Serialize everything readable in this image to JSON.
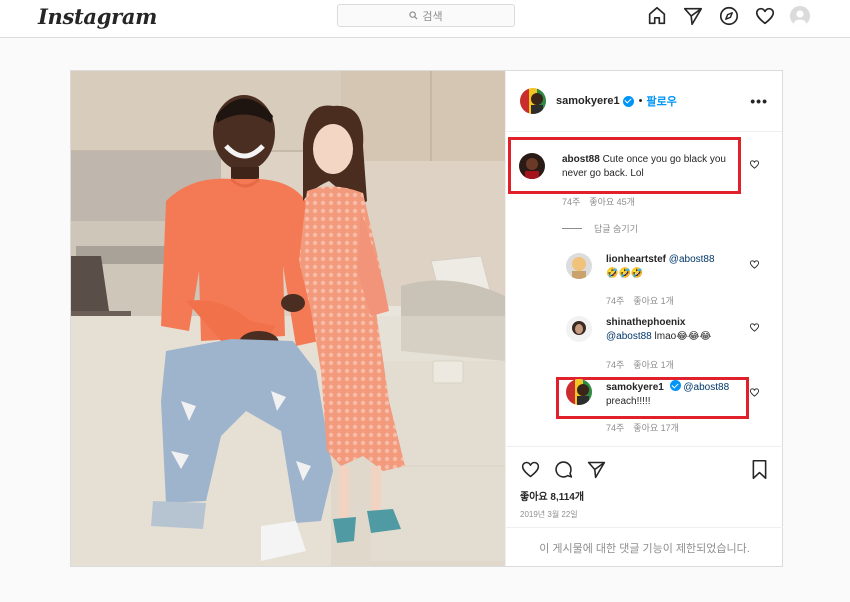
{
  "app": {
    "logo": "Instagram",
    "search_placeholder": "검색"
  },
  "post": {
    "author": "samokyere1",
    "follow_label": "팔로우",
    "dot": "•",
    "more": "•••",
    "likes_text": "좋아요 8,114개",
    "date": "2019년 3월 22일",
    "comments_disabled": "이 게시물에 대한 댓글 기능이 제한되었습니다."
  },
  "comments": [
    {
      "user": "abost88",
      "text": "Cute once you go black you never go back. Lol",
      "time": "74주",
      "likes": "좋아요 45개",
      "highlighted": true
    }
  ],
  "hide_replies": "답글 숨기기",
  "replies": [
    {
      "user": "lionheartstef",
      "mention": "@abost88",
      "text": "🤣🤣🤣",
      "time": "74주",
      "likes": "좋아요 1개",
      "highlighted": false
    },
    {
      "user": "shinathephoenix",
      "mention": "@abost88",
      "text": "lmao😂😂😂",
      "time": "74주",
      "likes": "좋아요 1개",
      "highlighted": false
    },
    {
      "user": "samokyere1",
      "mention": "@abost88",
      "text": "preach!!!!!",
      "time": "74주",
      "likes": "좋아요 17개",
      "highlighted": true,
      "verified": true
    }
  ],
  "icons": {
    "search": "search-icon",
    "home": "home-icon",
    "direct": "direct-icon",
    "explore": "compass-icon",
    "activity": "heart-icon",
    "profile": "avatar",
    "like": "heart-icon",
    "comment": "comment-icon",
    "share": "share-icon",
    "save": "bookmark-icon"
  },
  "colors": {
    "accent": "#0095f6",
    "highlight_box": "#e0202b",
    "border": "#dbdbdb",
    "muted": "#8e8e8e"
  }
}
